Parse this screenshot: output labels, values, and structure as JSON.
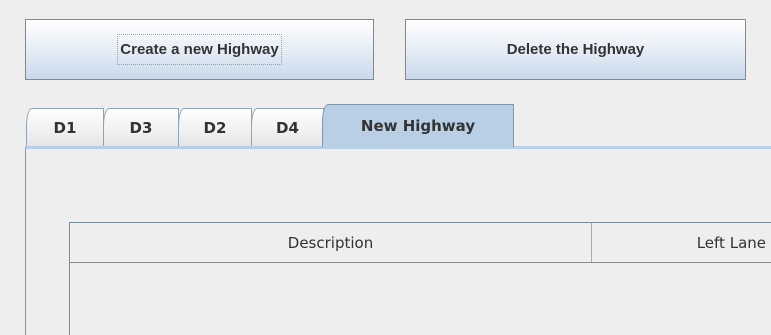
{
  "toolbar": {
    "create_label": "Create a new Highway",
    "delete_label": "Delete the Highway"
  },
  "tabs": [
    {
      "label": "D1"
    },
    {
      "label": "D3"
    },
    {
      "label": "D2"
    },
    {
      "label": "D4"
    },
    {
      "label": "New Highway",
      "active": true
    }
  ],
  "table": {
    "columns": [
      "Description",
      "Left Lane"
    ]
  },
  "colors": {
    "active_tab": "#b9cfe5",
    "border": "#7d97b3"
  }
}
